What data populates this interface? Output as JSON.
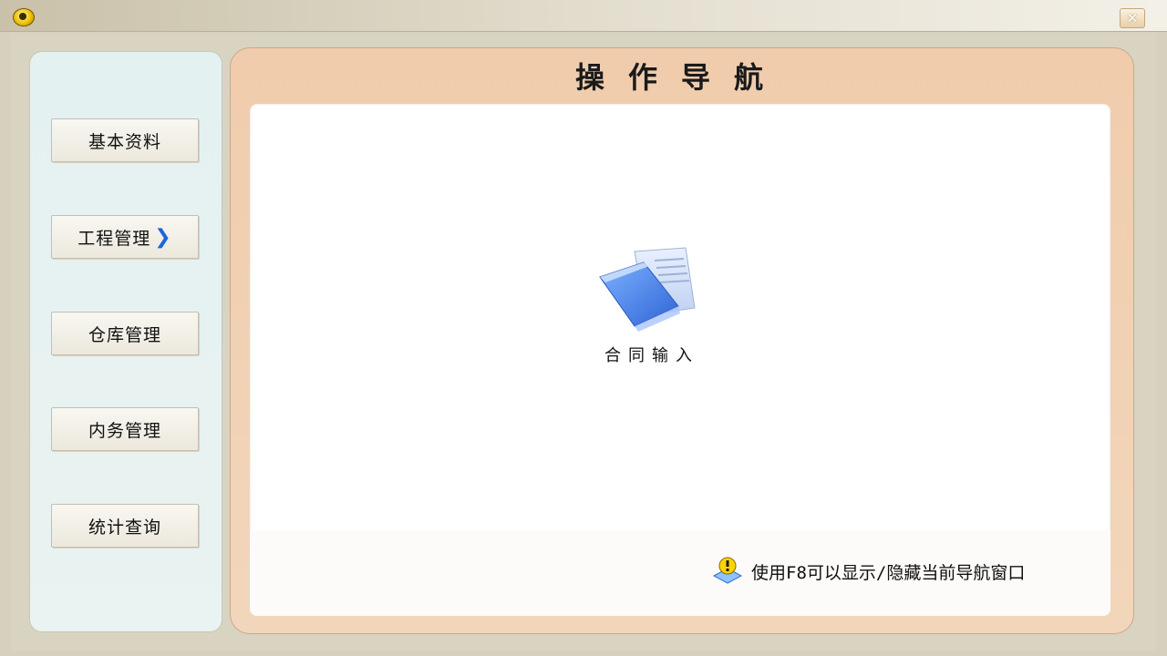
{
  "window": {
    "close_symbol": "✕"
  },
  "sidebar": {
    "items": [
      {
        "label": "基本资料"
      },
      {
        "label": "工程管理",
        "arrow": "❯"
      },
      {
        "label": "仓库管理"
      },
      {
        "label": "内务管理"
      },
      {
        "label": "统计查询"
      }
    ]
  },
  "main": {
    "title": "操作导航",
    "shortcut": {
      "label": "合同输入",
      "icon": "document-icon"
    },
    "hint": {
      "text": "使用F8可以显示/隐藏当前导航窗口",
      "icon": "info-warning-icon"
    }
  },
  "colors": {
    "accent_blue": "#1a68d8",
    "frame_peach": "#f0ccac",
    "sidebar_bg": "#e4f1f1"
  }
}
